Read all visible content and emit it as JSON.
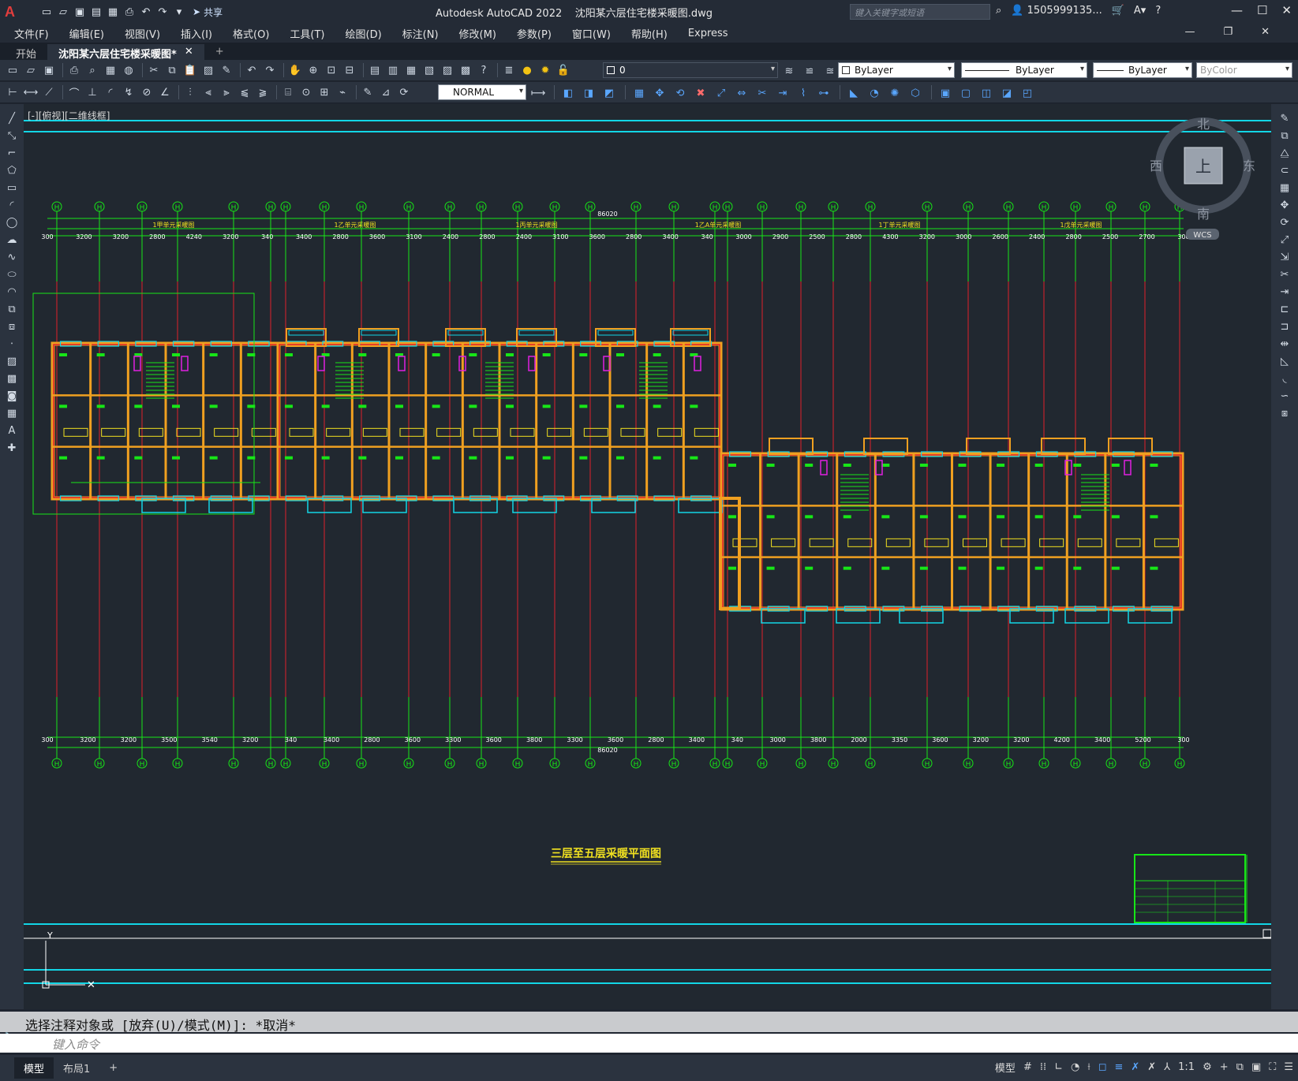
{
  "window": {
    "app_name": "Autodesk AutoCAD 2022",
    "file_name": "沈阳某六层住宅楼采暖图.dwg",
    "share_label": "共享",
    "search_placeholder": "键入关键字或短语",
    "user": "1505999135...",
    "help": "?"
  },
  "menu": [
    "文件(F)",
    "编辑(E)",
    "视图(V)",
    "插入(I)",
    "格式(O)",
    "工具(T)",
    "绘图(D)",
    "标注(N)",
    "修改(M)",
    "参数(P)",
    "窗口(W)",
    "帮助(H)",
    "Express"
  ],
  "tabs": {
    "start": "开始",
    "drawing": "沈阳某六层住宅楼采暖图*",
    "close": "✕",
    "add": "+"
  },
  "toolbar": {
    "layer": "0",
    "color": "ByLayer",
    "linetype": "ByLayer",
    "lineweight": "ByLayer",
    "plotstyle": "ByColor",
    "textstyle": "NORMAL"
  },
  "viewport": {
    "label": "[-][俯视][二维线框]",
    "viewcube": {
      "north": "北",
      "south": "南",
      "east": "东",
      "west": "西",
      "top": "上",
      "wcs": "WCS"
    }
  },
  "drawing": {
    "plan_title": "三层至五层采暖平面图",
    "total_dim": "86020",
    "unit_labels": [
      "1甲单元采暖图",
      "1乙单元采暖图",
      "1丙单元采暖图",
      "1乙A单元采暖图",
      "1丁单元采暖图",
      "1戊单元采暖图"
    ],
    "top_dims": [
      "300",
      "3200",
      "3200",
      "2800",
      "4240",
      "3200",
      "340",
      "3400",
      "2800",
      "3600",
      "3100",
      "2400",
      "2800",
      "2400",
      "3100",
      "3600",
      "2800",
      "3400",
      "340",
      "3000",
      "2900",
      "2500",
      "2800",
      "4300",
      "3200",
      "3000",
      "2600",
      "2400",
      "2800",
      "2500",
      "2700",
      "300"
    ],
    "bottom_dims": [
      "300",
      "3200",
      "3200",
      "3500",
      "3540",
      "3200",
      "340",
      "3400",
      "2800",
      "3600",
      "3300",
      "3600",
      "3800",
      "3300",
      "3600",
      "2800",
      "3400",
      "340",
      "3000",
      "3800",
      "2000",
      "3350",
      "3600",
      "3200",
      "3200",
      "4200",
      "3400",
      "5200",
      "300"
    ],
    "axis_bubble": "H"
  },
  "command": {
    "history": "选择注释对象或 [放弃(U)/模式(M)]: *取消*",
    "placeholder": "键入命令"
  },
  "layouts": [
    "模型",
    "布局1",
    "+"
  ],
  "status": {
    "model": "模型",
    "scale": "1:1"
  },
  "colors": {
    "background": "#212830",
    "axis_red": "#e0202a",
    "dim_green": "#17e617",
    "wall_orange": "#f0a020",
    "window_cyan": "#12d6e6",
    "magenta": "#e020e0",
    "yellow": "#f0e020"
  }
}
